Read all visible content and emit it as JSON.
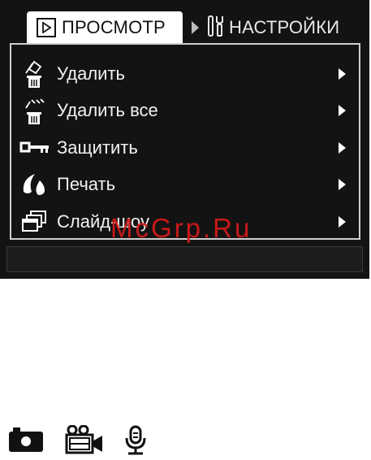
{
  "tabs": {
    "active": {
      "label": "ПРОСМОТР",
      "icon": "playback-icon"
    },
    "inactive": {
      "label": "НАСТРОЙКИ",
      "icon": "tools-icon"
    }
  },
  "menu": {
    "items": [
      {
        "label": "Удалить",
        "icon": "delete-icon"
      },
      {
        "label": "Удалить все",
        "icon": "delete-all-icon"
      },
      {
        "label": "Защитить",
        "icon": "key-icon"
      },
      {
        "label": "Печать",
        "icon": "print-icon"
      },
      {
        "label": "Слайд-шоу",
        "icon": "slideshow-icon"
      }
    ]
  },
  "watermark": "McGrp.Ru",
  "modes": [
    {
      "name": "camera-icon"
    },
    {
      "name": "video-camera-icon"
    },
    {
      "name": "microphone-icon"
    }
  ],
  "colors": {
    "screen_bg": "#131313",
    "text": "#f2f2f2",
    "watermark": "#d11a1a"
  }
}
